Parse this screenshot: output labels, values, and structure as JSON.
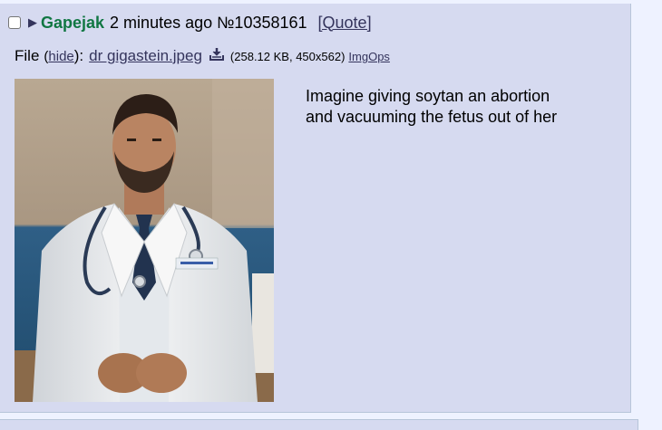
{
  "post": {
    "name": "Gapejak",
    "date": "2 minutes ago",
    "number": "№10358161",
    "quote_label": "[Quote]",
    "file": {
      "label": "File",
      "open_paren": "(",
      "hide_label": "hide",
      "close_paren": "):",
      "filename": "dr gigastein.jpeg",
      "meta": "(258.12 KB, 450x562)",
      "imgops_label": "ImgOps",
      "download_icon": "download-icon"
    },
    "message_lines": [
      "Imagine giving soytan an abortion",
      "and vacuuming the fetus out of her"
    ]
  },
  "colors": {
    "post_bg": "#d6daf0",
    "page_bg": "#eef2ff",
    "name": "#117743",
    "link": "#34345c",
    "border": "#b7c5d9"
  }
}
